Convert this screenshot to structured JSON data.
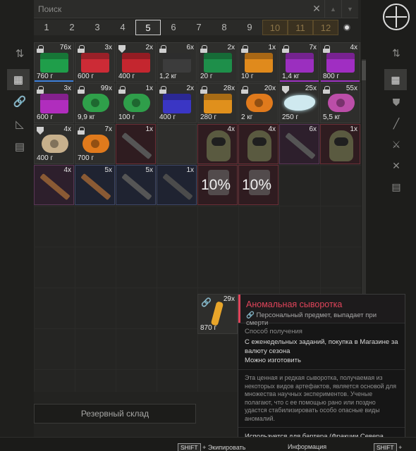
{
  "search": {
    "placeholder": "Поиск"
  },
  "pages": [
    "1",
    "2",
    "3",
    "4",
    "5",
    "6",
    "7",
    "8",
    "9",
    "10",
    "11",
    "12"
  ],
  "active_page": "5",
  "items": [
    {
      "qty": "76x",
      "weight": "760 г",
      "icon": "lock-icon",
      "art": "box",
      "color": "#1f9e4a",
      "bar": "#3a7dd8",
      "hl": ""
    },
    {
      "qty": "3x",
      "weight": "600 г",
      "icon": "lock-icon",
      "art": "box",
      "color": "#cc2b36",
      "bar": "",
      "hl": ""
    },
    {
      "qty": "2x",
      "weight": "400 г",
      "icon": "shield-icon",
      "art": "box",
      "color": "#c4262f",
      "bar": "",
      "hl": ""
    },
    {
      "qty": "6x",
      "weight": "1,2 кг",
      "icon": "lock-icon",
      "art": "box",
      "color": "#3c3c3c",
      "bar": "",
      "hl": ""
    },
    {
      "qty": "2x",
      "weight": "20 г",
      "icon": "lock-icon",
      "art": "box",
      "color": "#1e8f4a",
      "bar": "",
      "hl": ""
    },
    {
      "qty": "1x",
      "weight": "10 г",
      "icon": "lock-icon",
      "art": "box",
      "color": "#e08a1c",
      "bar": "",
      "hl": ""
    },
    {
      "qty": "7x",
      "weight": "1,4 кг",
      "icon": "lock-icon",
      "art": "box",
      "color": "#9b2fbf",
      "bar": "#9b2fbf",
      "hl": ""
    },
    {
      "qty": "4x",
      "weight": "800 г",
      "icon": "lock-icon",
      "art": "box",
      "color": "#a02ec2",
      "bar": "#9b2fbf",
      "hl": ""
    },
    {
      "qty": "3x",
      "weight": "600 г",
      "icon": "lock-icon",
      "art": "box",
      "color": "#b02dbd",
      "bar": "",
      "hl": ""
    },
    {
      "qty": "99x",
      "weight": "9,9 кг",
      "icon": "lock-icon",
      "art": "roll",
      "color": "#2fa04a",
      "bar": "",
      "hl": ""
    },
    {
      "qty": "1x",
      "weight": "100 г",
      "icon": "lock-icon",
      "art": "roll",
      "color": "#2f9e4a",
      "bar": "",
      "hl": ""
    },
    {
      "qty": "2x",
      "weight": "400 г",
      "icon": "lock-icon",
      "art": "box",
      "color": "#3a36c4",
      "bar": "",
      "hl": ""
    },
    {
      "qty": "28x",
      "weight": "280 г",
      "icon": "lock-icon",
      "art": "box",
      "color": "#e0901c",
      "bar": "",
      "hl": ""
    },
    {
      "qty": "20x",
      "weight": "2 кг",
      "icon": "lock-icon",
      "art": "roll",
      "color": "#e07a1c",
      "bar": "",
      "hl": ""
    },
    {
      "qty": "25x",
      "weight": "250 г",
      "icon": "shield-icon",
      "art": "crystal",
      "color": "#cfe9ef",
      "bar": "",
      "hl": ""
    },
    {
      "qty": "55x",
      "weight": "5,5 кг",
      "icon": "lock-icon",
      "art": "roll",
      "color": "#bb4ea8",
      "bar": "",
      "hl": ""
    },
    {
      "qty": "4x",
      "weight": "400 г",
      "icon": "shield-icon",
      "art": "roll",
      "color": "#c7b08c",
      "bar": "",
      "hl": ""
    },
    {
      "qty": "7x",
      "weight": "700 г",
      "icon": "lock-icon",
      "art": "roll",
      "color": "#e07a1c",
      "bar": "",
      "hl": ""
    },
    {
      "qty": "1x",
      "weight": "",
      "icon": "",
      "art": "gun",
      "color": "",
      "bar": "",
      "hl": "hl-r"
    },
    {
      "qty": "",
      "weight": "",
      "icon": "",
      "art": "",
      "color": "",
      "bar": "",
      "hl": ""
    },
    {
      "qty": "4x",
      "weight": "",
      "icon": "",
      "art": "helmet",
      "color": "",
      "bar": "",
      "hl": "hl-r"
    },
    {
      "qty": "4x",
      "weight": "",
      "icon": "",
      "art": "helmet",
      "color": "",
      "bar": "",
      "hl": "hl-r"
    },
    {
      "qty": "6x",
      "weight": "",
      "icon": "",
      "art": "gun",
      "color": "",
      "bar": "",
      "hl": "hl-p"
    },
    {
      "qty": "1x",
      "weight": "",
      "icon": "",
      "art": "helmet",
      "color": "",
      "bar": "",
      "hl": "hl-r"
    },
    {
      "qty": "4x",
      "weight": "",
      "icon": "",
      "art": "gun-shot",
      "color": "",
      "bar": "",
      "hl": "hl-p"
    },
    {
      "qty": "5x",
      "weight": "",
      "icon": "",
      "art": "gun-shot",
      "color": "",
      "bar": "",
      "hl": "hl-b"
    },
    {
      "qty": "5x",
      "weight": "",
      "icon": "",
      "art": "gun",
      "color": "",
      "bar": "",
      "hl": "hl-b"
    },
    {
      "qty": "1x",
      "weight": "",
      "icon": "",
      "art": "gun-dark",
      "color": "",
      "bar": "",
      "hl": "hl-b"
    },
    {
      "qty": "",
      "weight": "",
      "icon": "",
      "art": "pct",
      "pct": "10%",
      "color": "",
      "bar": "",
      "hl": "hl-r"
    },
    {
      "qty": "",
      "weight": "",
      "icon": "",
      "art": "pct",
      "pct": "10%",
      "color": "",
      "bar": "",
      "hl": "hl-r"
    }
  ],
  "selected_item": {
    "qty": "29x",
    "weight": "870 г"
  },
  "tooltip": {
    "name": "Аномальная сыворотка",
    "personal": "Персональный предмет, выпадает при смерти",
    "obtain_label": "Способ получения",
    "obtain_text": "С еженедельных заданий, покупка в Магазине за валюту сезона",
    "craftable": "Можно изготовить",
    "description": "Эта ценная и редкая сыворотка, получаемая из некоторых видов артефактов, является основой для множества научных экспериментов. Ученые полагают, что с ее помощью рано или поздно удастся стабилизировать особо опасные виды аномалий.",
    "barter": "Используется для бартера (Фракции Севера, Обитель «Завета»)"
  },
  "storage_tab": "Резервный склад",
  "hints": [
    {
      "key": "SHIFT",
      "label": "Экипировать"
    },
    {
      "key": "",
      "label": "Информация"
    },
    {
      "key": "SHIFT",
      "label": ""
    }
  ],
  "accent": "#e0445a"
}
